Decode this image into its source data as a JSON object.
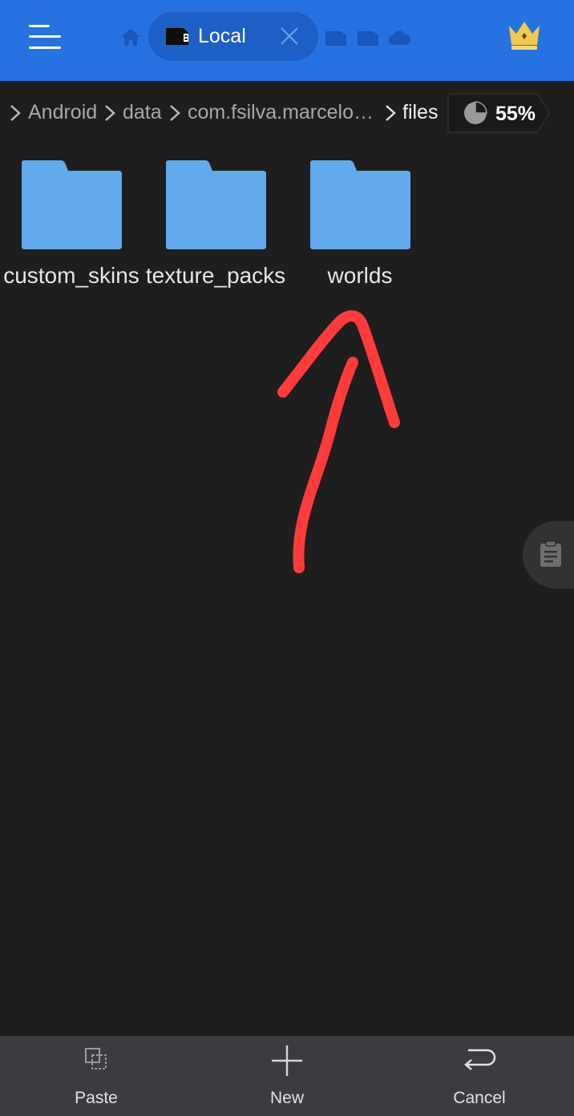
{
  "toolbar": {
    "tabs": [
      {
        "icon": "home-icon"
      },
      {
        "icon": "sd-card-icon",
        "label": "Local",
        "active": true
      },
      {
        "icon": "storage-icon"
      },
      {
        "icon": "storage-icon"
      },
      {
        "icon": "cloud-icon"
      }
    ],
    "premium_icon": "crown-icon",
    "accent": "#2672e0"
  },
  "breadcrumb": {
    "items": [
      "Android",
      "data",
      "com.fsilva.marcelo…",
      "files"
    ],
    "storage_percent": "55%"
  },
  "folders": [
    {
      "name": "custom_skins",
      "icon": "folder-icon"
    },
    {
      "name": "texture_packs",
      "icon": "folder-icon"
    },
    {
      "name": "worlds",
      "icon": "folder-icon"
    }
  ],
  "annotation": {
    "shape": "arrow",
    "color": "#ff3b3b"
  },
  "bottom_bar": {
    "paste": "Paste",
    "new": "New",
    "cancel": "Cancel"
  },
  "colors": {
    "folder": "#62aaeb",
    "background": "#1f1e1e",
    "bottom_bar": "#3a3c40"
  }
}
